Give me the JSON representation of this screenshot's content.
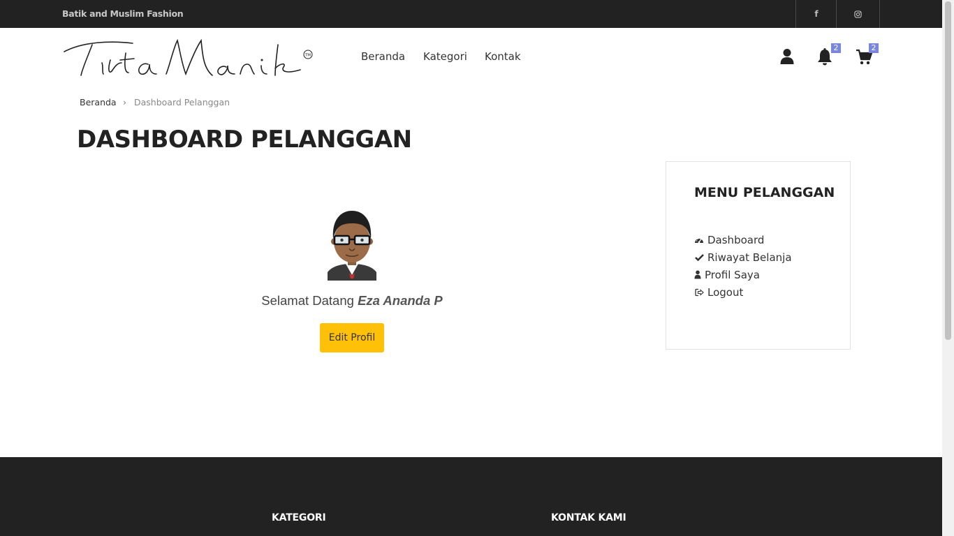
{
  "topbar": {
    "tagline": "Batik and Muslim Fashion",
    "social": [
      {
        "name": "facebook-icon",
        "glyph": "f"
      },
      {
        "name": "instagram-icon",
        "glyph": "◎"
      }
    ]
  },
  "header": {
    "logo_text": "Tirta Manik",
    "logo_mark": "TM",
    "nav": [
      "Beranda",
      "Kategori",
      "Kontak"
    ],
    "notification_count": "2",
    "cart_count": "2"
  },
  "breadcrumb": {
    "home": "Beranda",
    "separator": "›",
    "current": "Dashboard Pelanggan"
  },
  "page": {
    "title": "DASHBOARD PELANGGAN",
    "welcome_text": "Selamat Datang ",
    "user_name": "Eza Ananda P",
    "edit_button": "Edit Profil"
  },
  "customer_menu": {
    "title": "MENU PELANGGAN",
    "items": [
      {
        "label": "Dashboard",
        "icon": "dashboard-icon"
      },
      {
        "label": "Riwayat Belanja",
        "icon": "check-icon"
      },
      {
        "label": "Profil Saya",
        "icon": "user-icon"
      },
      {
        "label": "Logout",
        "icon": "logout-icon"
      }
    ]
  },
  "footer": {
    "headings": [
      "KATEGORI",
      "KONTAK KAMI"
    ]
  },
  "colors": {
    "topbar_bg": "#222222",
    "accent_button": "#ffc107",
    "badge": "#7986e0"
  }
}
